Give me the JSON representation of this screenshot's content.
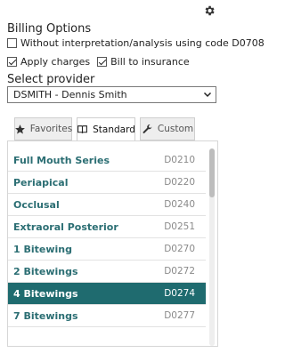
{
  "header": {
    "gear_icon": "gear-icon"
  },
  "billing": {
    "title": "Billing Options",
    "without_interpretation": {
      "label": "Without interpretation/analysis using code D0708",
      "checked": false
    },
    "apply_charges": {
      "label": "Apply charges",
      "checked": true
    },
    "bill_to_insurance": {
      "label": "Bill to insurance",
      "checked": true
    }
  },
  "provider": {
    "title": "Select provider",
    "selected": "DSMITH - Dennis Smith"
  },
  "tabs": [
    {
      "label": "Favorites",
      "icon": "star-icon",
      "active": false
    },
    {
      "label": "Standard",
      "icon": "book-icon",
      "active": true
    },
    {
      "label": "Custom",
      "icon": "wrench-icon",
      "active": false
    }
  ],
  "list": {
    "items": [
      {
        "name": "Full Mouth Series",
        "code": "D0210"
      },
      {
        "name": "Periapical",
        "code": "D0220"
      },
      {
        "name": "Occlusal",
        "code": "D0240"
      },
      {
        "name": "Extraoral Posterior",
        "code": "D0251"
      },
      {
        "name": "1 Bitewing",
        "code": "D0270"
      },
      {
        "name": "2 Bitewings",
        "code": "D0272"
      },
      {
        "name": "4 Bitewings",
        "code": "D0274"
      },
      {
        "name": "7 Bitewings",
        "code": "D0277"
      }
    ],
    "selected_index": 6,
    "scroll_fraction": 0.0
  },
  "colors": {
    "accent": "#1f6b6f",
    "item_text": "#2b6e73",
    "code_text": "#8a8a8a"
  }
}
